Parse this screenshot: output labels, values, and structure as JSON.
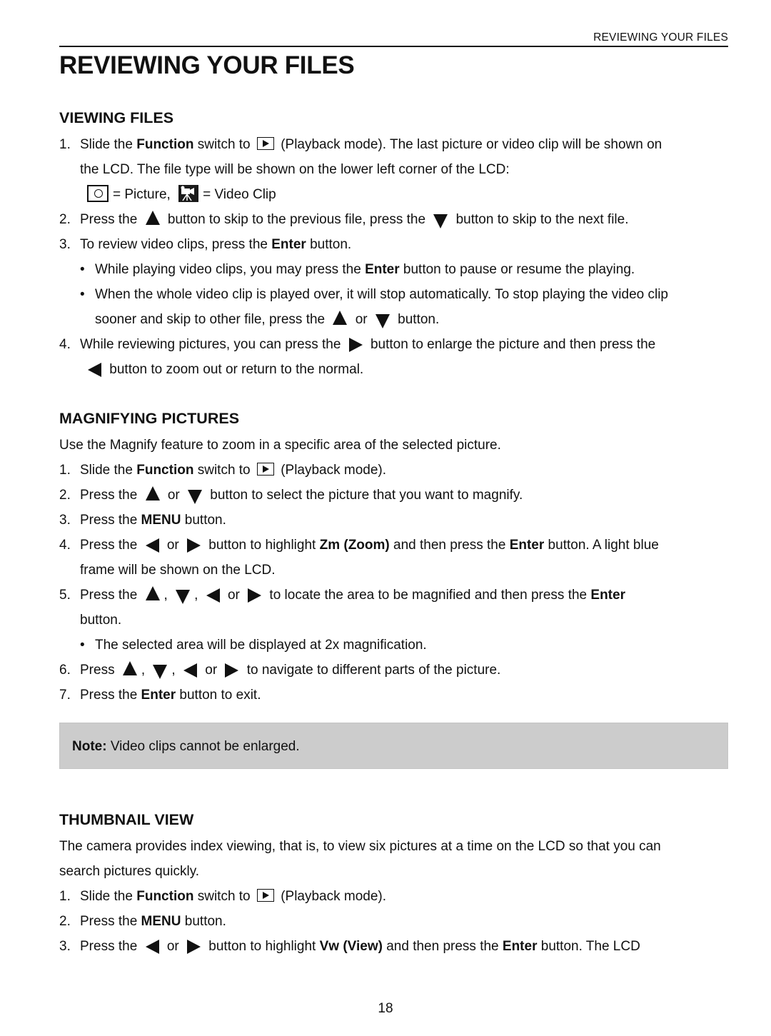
{
  "header": {
    "running_title": "REVIEWING YOUR FILES",
    "page_title": "REVIEWING YOUR FILES"
  },
  "viewing_files": {
    "title": "VIEWING FILES",
    "step1": {
      "num": "1.",
      "a": "Slide the ",
      "bold1": "Function",
      "b": " switch to ",
      "c": " (Playback mode). The last picture or video clip will be shown on",
      "cont": "the LCD. The file type will be shown on the lower left corner of the LCD:",
      "legend_picture": "= Picture,",
      "legend_video": "= Video Clip"
    },
    "step2": {
      "num": "2.",
      "a": "Press the",
      "b": "button to skip to the previous file, press the",
      "c": "button to skip to the next file."
    },
    "step3": {
      "num": "3.",
      "a": "To review video clips, press the ",
      "bold1": "Enter",
      "b": " button."
    },
    "bullet1": {
      "a": "While playing video clips, you may press the ",
      "bold1": "Enter",
      "b": " button to pause or resume the playing."
    },
    "bullet2": {
      "a": "When the whole video clip is played over, it will stop automatically. To stop playing the video clip",
      "cont_a": "sooner and skip to other file, press the",
      "cont_or": "or",
      "cont_b": "button."
    },
    "step4": {
      "num": "4.",
      "a": "While reviewing pictures, you can press the",
      "b": "button to enlarge the picture and then press the",
      "cont": "button to zoom out or return to the normal."
    }
  },
  "magnifying": {
    "title": "MAGNIFYING PICTURES",
    "intro": "Use the Magnify feature to zoom in a specific area of the selected picture.",
    "step1": {
      "num": "1.",
      "a": "Slide the ",
      "bold1": "Function",
      "b": " switch to ",
      "c": " (Playback mode)."
    },
    "step2": {
      "num": "2.",
      "a": "Press the",
      "or": "or",
      "b": "button to select the picture that you want to magnify."
    },
    "step3": {
      "num": "3.",
      "a": "Press the ",
      "bold1": "MENU",
      "b": " button."
    },
    "step4": {
      "num": "4.",
      "a": "Press the",
      "or": "or",
      "b": "button to highlight ",
      "bold1": "Zm (Zoom)",
      "c": " and then press the ",
      "bold2": "Enter",
      "d": " button. A light blue",
      "cont": "frame will be shown on the LCD."
    },
    "step5": {
      "num": "5.",
      "a": "Press the",
      "comma": ",",
      "or": "or",
      "b": "to locate the area to be magnified and then press the ",
      "bold1": "Enter",
      "cont": "button."
    },
    "bullet1": "The selected area will be displayed at 2x magnification.",
    "step6": {
      "num": "6.",
      "a": "Press",
      "comma": ",",
      "or": "or",
      "b": "to navigate to different parts of the picture."
    },
    "step7": {
      "num": "7.",
      "a": "Press the ",
      "bold1": "Enter",
      "b": " button to exit."
    }
  },
  "note": {
    "label": "Note:",
    "text": " Video clips cannot be enlarged."
  },
  "thumbnail": {
    "title": "THUMBNAIL VIEW",
    "intro1": "The camera provides index viewing, that is, to view six pictures at a time on the LCD so that you can",
    "intro2": "search pictures quickly.",
    "step1": {
      "num": "1.",
      "a": "Slide the ",
      "bold1": "Function",
      "b": " switch to ",
      "c": " (Playback mode)."
    },
    "step2": {
      "num": "2.",
      "a": "Press the ",
      "bold1": "MENU",
      "b": " button."
    },
    "step3": {
      "num": "3.",
      "a": "Press the",
      "or": "or",
      "b": "button to highlight ",
      "bold1": "Vw (View)",
      "c": " and then press the ",
      "bold2": "Enter",
      "d": " button. The LCD"
    }
  },
  "footer": {
    "page_number": "18"
  },
  "colors": {
    "text": "#111111",
    "note_background": "#cccccc",
    "rule": "#111111"
  }
}
